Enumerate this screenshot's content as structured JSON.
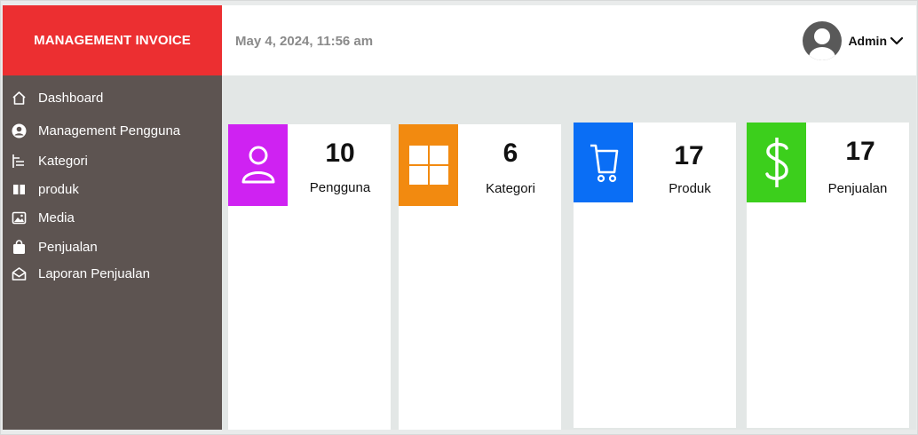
{
  "brand": {
    "title": "MANAGEMENT INVOICE"
  },
  "header": {
    "datetime": "May 4, 2024, 11:56 am",
    "user_name": "Admin"
  },
  "sidebar": {
    "items": [
      {
        "label": "Dashboard",
        "icon": "home-icon"
      },
      {
        "label": "Management  Pengguna",
        "icon": "user-circle-icon"
      },
      {
        "label": "Kategori",
        "icon": "list-tree-icon"
      },
      {
        "label": "produk",
        "icon": "book-icon"
      },
      {
        "label": "Media",
        "icon": "image-icon"
      },
      {
        "label": "Penjualan",
        "icon": "shopping-bag-icon"
      },
      {
        "label": "Laporan Penjualan",
        "icon": "envelope-icon"
      }
    ]
  },
  "cards": [
    {
      "value": "10",
      "label": "Pengguna",
      "color": "#cf22f2",
      "icon": "user-icon"
    },
    {
      "value": "6",
      "label": "Kategori",
      "color": "#f28a10",
      "icon": "grid-icon"
    },
    {
      "value": "17",
      "label": "Produk",
      "color": "#0a6ef5",
      "icon": "cart-icon"
    },
    {
      "value": "17",
      "label": "Penjualan",
      "color": "#3ccf1c",
      "icon": "dollar-icon"
    }
  ],
  "colors": {
    "brand": "#ec2f31",
    "sidebar": "#5d5451",
    "content_bg": "#e3e7e6"
  }
}
